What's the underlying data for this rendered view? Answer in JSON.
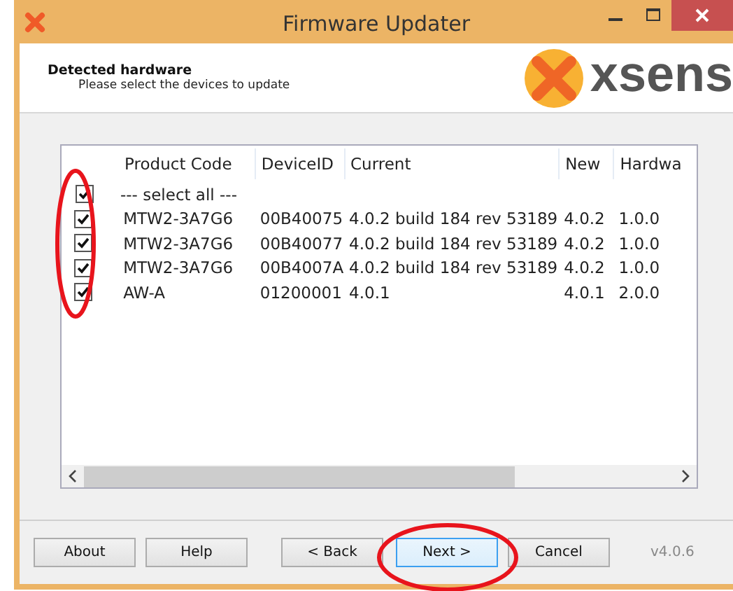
{
  "window": {
    "title": "Firmware Updater",
    "controls": [
      {
        "kind": "minimize"
      },
      {
        "kind": "maximize"
      },
      {
        "kind": "close"
      }
    ]
  },
  "header": {
    "title": "Detected hardware",
    "subtitle": "Please select the devices to update",
    "logo_text": "xsens"
  },
  "table": {
    "columns": [
      "Product Code",
      "DeviceID",
      "Current",
      "New",
      "Hardwa"
    ],
    "select_all": {
      "label": "--- select all ---",
      "checked": true
    },
    "rows": [
      {
        "checked": true,
        "cells": [
          "MTW2-3A7G6",
          "00B40075",
          "4.0.2 build 184 rev 53189",
          "4.0.2",
          "1.0.0"
        ]
      },
      {
        "checked": true,
        "cells": [
          "MTW2-3A7G6",
          "00B40077",
          "4.0.2 build 184 rev 53189",
          "4.0.2",
          "1.0.0"
        ]
      },
      {
        "checked": true,
        "cells": [
          "MTW2-3A7G6",
          "00B4007A",
          "4.0.2 build 184 rev 53189",
          "4.0.2",
          "1.0.0"
        ]
      },
      {
        "checked": true,
        "cells": [
          "AW-A",
          "01200001",
          "4.0.1",
          "4.0.1",
          "2.0.0"
        ]
      }
    ]
  },
  "buttons": [
    {
      "label": "About",
      "focused": false
    },
    {
      "label": "Help",
      "focused": false
    },
    {
      "label": "< Back",
      "focused": false
    },
    {
      "label": "Next >",
      "focused": true
    },
    {
      "label": "Cancel",
      "focused": false
    }
  ],
  "version": "v4.0.6",
  "annotations": [
    {
      "kind": "ellipse"
    },
    {
      "kind": "ellipse"
    }
  ]
}
